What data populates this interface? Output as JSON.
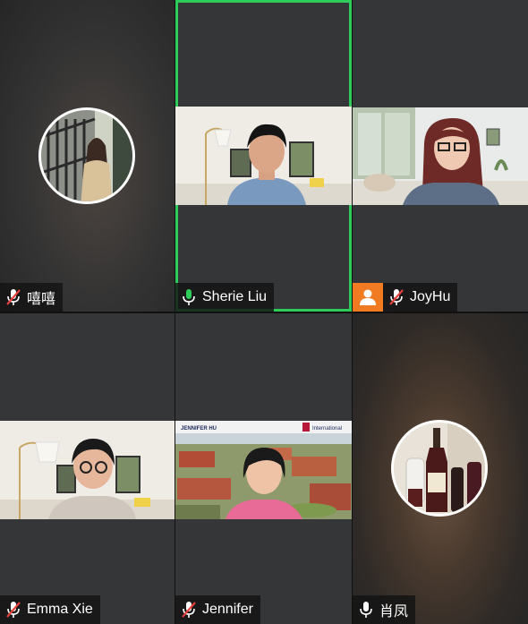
{
  "participants": [
    {
      "name": "嘻嘻",
      "mic": "muted",
      "video": "avatar"
    },
    {
      "name": "Sherie Liu",
      "mic": "active",
      "video": "on",
      "speaking": true
    },
    {
      "name": "JoyHu",
      "mic": "muted",
      "video": "on",
      "host": true
    },
    {
      "name": "Emma Xie",
      "mic": "muted",
      "video": "on"
    },
    {
      "name": "Jennifer",
      "mic": "muted",
      "video": "on"
    },
    {
      "name": "肖凤",
      "mic": "unmuted",
      "video": "avatar"
    }
  ],
  "jennifer_background": {
    "caption_left": "JENNIFER HU",
    "caption_right": "International"
  },
  "colors": {
    "active_speaker": "#2ecc5a",
    "mic_active": "#2ecc5a",
    "mic_muted": "#e8413b",
    "host_badge": "#f07b22"
  }
}
